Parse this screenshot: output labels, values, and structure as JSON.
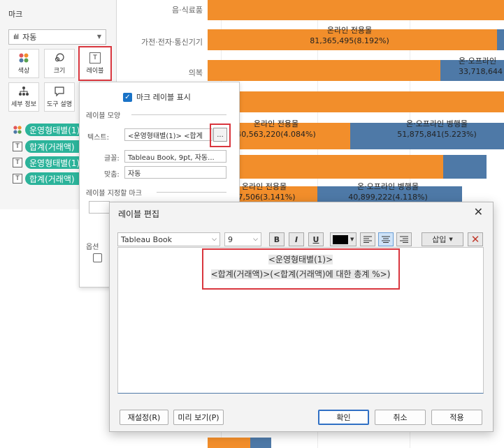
{
  "marks": {
    "title": "마크",
    "mark_type": "자동",
    "buttons": [
      "색상",
      "크기",
      "레이블",
      "세부 정보",
      "도구 설명"
    ],
    "fields": [
      "운영형태별(1)",
      "합계(거래액)",
      "운영형태별(1)",
      "합계(거래액)"
    ]
  },
  "chart": {
    "rows": [
      "음·식료품",
      "가전·전자·통신기기",
      "의복"
    ],
    "labels": [
      {
        "line1": "온라인 전용몰",
        "line2": "81,365,495(8.192%)"
      },
      {
        "line1": "온·오프라인",
        "line2": "33,718,644"
      },
      {
        "line1": "온라인 전용몰",
        "line2": "40,563,220(4.084%)"
      },
      {
        "line1": "온·오프라인 병행몰",
        "line2": "51,875,841(5.223%)"
      },
      {
        "line1": "온라인 전용몰",
        "line2": "97,506(3.141%)"
      },
      {
        "line1": "온·오프라인 병행몰",
        "line2": "40,899,222(4.118%)"
      }
    ],
    "colors": {
      "online": "#f28e2b",
      "offline": "#4e79a7"
    }
  },
  "popover": {
    "show_labels": "마크 레이블 표시",
    "appearance": "레이블 모양",
    "text_label": "텍스트:",
    "text_value": "<운영형태별(1)> <합계",
    "dots": "...",
    "font_label": "글꼴:",
    "font_value": "Tableau Book, 9pt, 자동...",
    "align_label": "맞춤:",
    "align_value": "자동",
    "marks_to_label": "레이블 지정할 마크",
    "options": "옵션"
  },
  "dialog": {
    "title": "레이블 편집",
    "font": "Tableau Book",
    "size": "9",
    "bold": "B",
    "italic": "I",
    "underline": "U",
    "insert": "삽입",
    "line1": "<운영형태별(1)>",
    "line2_field": "<합계(거래액)>",
    "line2_rest": "(<합계(거래액)에 대한 총계 %>)",
    "reset": "재설정(R)",
    "preview": "미리 보기(P)",
    "ok": "확인",
    "cancel": "취소",
    "apply": "적용"
  }
}
